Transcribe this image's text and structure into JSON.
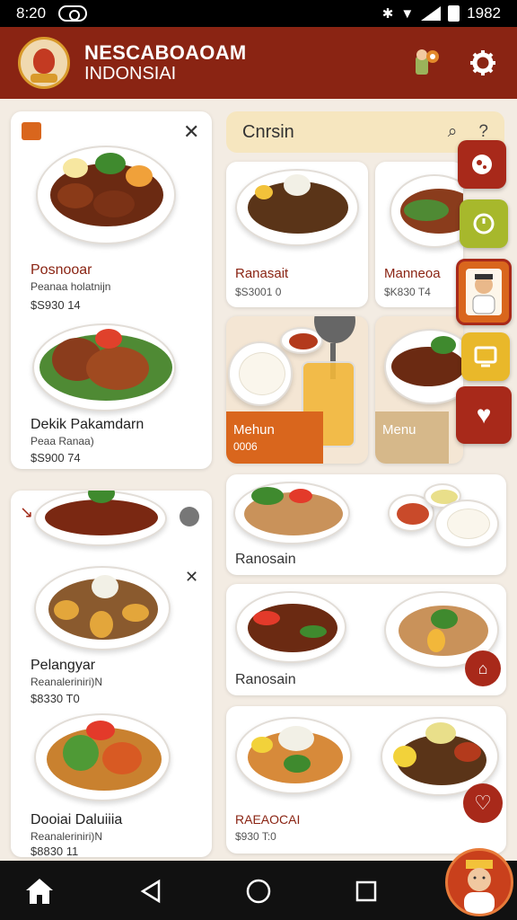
{
  "status_bar": {
    "time": "8:20",
    "clock_right": "1982"
  },
  "header": {
    "brand_line1": "NESCABOAOAM",
    "brand_line2": "INDONSIAI"
  },
  "search": {
    "query": "Cnrsin"
  },
  "left_column": {
    "card1": {
      "dish1": {
        "title": "Posnooar",
        "subtitle": "Peanaa holatnijn",
        "price": "$S930 14"
      },
      "dish2": {
        "title": "Dekik Pakamdarn",
        "subtitle": "Peaa Ranaa)",
        "price": "$S900 74"
      }
    },
    "card2": {
      "dish1": {
        "title": "Pelangyar",
        "subtitle": "Reanaleriniri)N",
        "price": "$8330 T0"
      },
      "dish2": {
        "title": "Dooiai Daluiiia",
        "subtitle": "Reanaleriniri)N",
        "price": "$8830 11"
      }
    }
  },
  "grid": {
    "tile1": {
      "title": "Ranasait",
      "price": "$S3001 0"
    },
    "tile2": {
      "title": "Manneoa",
      "price": "$K830 T4"
    },
    "tile3": {
      "title": "Mehun",
      "price": "0006"
    },
    "tile4": {
      "title": "Menu"
    },
    "row1": {
      "title": "Ranosain"
    },
    "row2": {
      "title": "Ranosain"
    },
    "row3": {
      "title": "RAEAOCAI",
      "price": "$930 T:0"
    }
  },
  "colors": {
    "header": "#8a2413",
    "accent_orange": "#d9661d",
    "search_bg": "#f6e6bf",
    "side_green": "#a7b82c",
    "side_yellow": "#e9b82a"
  },
  "icons": {
    "settings": "gear-icon",
    "profile_map": "map-pin-icon",
    "search": "search-icon",
    "help": "help-icon",
    "home": "home-icon",
    "back": "back-icon",
    "circle_home": "circle-icon",
    "recents": "square-icon",
    "heart": "heart-icon"
  }
}
